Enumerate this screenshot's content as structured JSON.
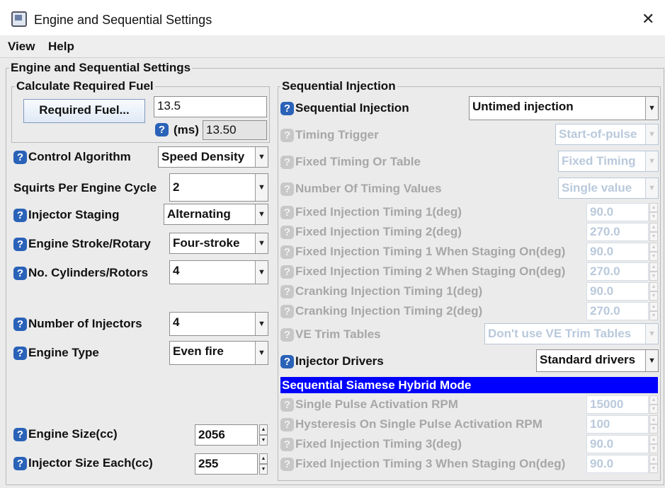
{
  "window": {
    "title": "Engine and Sequential Settings",
    "close_glyph": "✕"
  },
  "menu": {
    "view": "View",
    "help": "Help"
  },
  "panel": {
    "title": "Engine and Sequential Settings"
  },
  "required_fuel": {
    "group_title": "Calculate Required Fuel",
    "button_label": "Required Fuel...",
    "value": "13.5",
    "ms_label": "(ms)",
    "ms_value": "13.50"
  },
  "help_glyph": "?",
  "left": {
    "control_algorithm": {
      "label": "Control Algorithm",
      "value": "Speed Density"
    },
    "squirts": {
      "label": "Squirts Per Engine Cycle",
      "value": "2"
    },
    "injector_staging": {
      "label": "Injector Staging",
      "value": "Alternating"
    },
    "engine_stroke": {
      "label": "Engine Stroke/Rotary",
      "value": "Four-stroke"
    },
    "cylinders": {
      "label": "No. Cylinders/Rotors",
      "value": "4"
    },
    "num_injectors": {
      "label": "Number of Injectors",
      "value": "4"
    },
    "engine_type": {
      "label": "Engine Type",
      "value": "Even fire"
    },
    "engine_size": {
      "label": "Engine Size(cc)",
      "value": "2056"
    },
    "injector_size": {
      "label": "Injector Size Each(cc)",
      "value": "255"
    }
  },
  "right": {
    "group_title": "Sequential Injection",
    "seq_injection": {
      "label": "Sequential Injection",
      "value": "Untimed injection"
    },
    "timing_trigger": {
      "label": "Timing Trigger",
      "value": "Start-of-pulse"
    },
    "fixed_or_table": {
      "label": "Fixed Timing Or Table",
      "value": "Fixed Timing"
    },
    "num_timing_values": {
      "label": "Number Of Timing Values",
      "value": "Single value"
    },
    "fixed_timing_1": {
      "label": "Fixed Injection Timing 1(deg)",
      "value": "90.0"
    },
    "fixed_timing_2": {
      "label": "Fixed Injection Timing 2(deg)",
      "value": "270.0"
    },
    "fixed_timing_1_staging": {
      "label": "Fixed Injection Timing 1 When Staging On(deg)",
      "value": "90.0"
    },
    "fixed_timing_2_staging": {
      "label": "Fixed Injection Timing 2 When Staging On(deg)",
      "value": "270.0"
    },
    "cranking_timing_1": {
      "label": "Cranking Injection Timing 1(deg)",
      "value": "90.0"
    },
    "cranking_timing_2": {
      "label": "Cranking Injection Timing 2(deg)",
      "value": "270.0"
    },
    "ve_trim": {
      "label": "VE Trim Tables",
      "value": "Don't use VE Trim Tables"
    },
    "injector_drivers": {
      "label": "Injector Drivers",
      "value": "Standard drivers"
    },
    "siamese_title": "Sequential Siamese Hybrid Mode",
    "single_pulse_rpm": {
      "label": "Single Pulse Activation RPM",
      "value": "15000"
    },
    "hysteresis_rpm": {
      "label": "Hysteresis On Single Pulse Activation RPM",
      "value": "100"
    },
    "fixed_timing_3": {
      "label": "Fixed Injection Timing 3(deg)",
      "value": "90.0"
    },
    "fixed_timing_3_staging": {
      "label": "Fixed Injection Timing 3 When Staging On(deg)",
      "value": "90.0"
    }
  },
  "colors": {
    "help_icon": "#2a62b8",
    "banner": "#0000ff",
    "disabled_text": "#a7a7a7"
  }
}
